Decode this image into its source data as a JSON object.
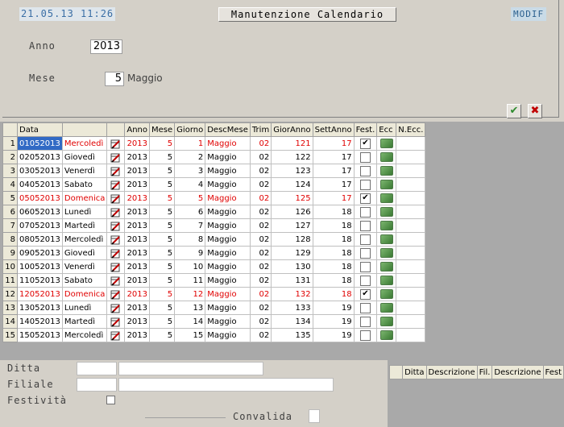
{
  "header": {
    "datetime": "21.05.13 11:26",
    "title": "Manutenzione Calendario",
    "mode": "MODIF"
  },
  "form": {
    "anno_label": "Anno",
    "anno_value": "2013",
    "mese_label": "Mese",
    "mese_value": "5",
    "mese_name": "Maggio"
  },
  "toolbar": {
    "confirm_icon": "checkmark-icon",
    "cancel_icon": "x-icon",
    "confirm_color": "#2e8b2e",
    "cancel_color": "#c00000"
  },
  "grid": {
    "columns": [
      "Data",
      "",
      "",
      "Anno",
      "Mese",
      "Giorno",
      "DescMese",
      "Trim",
      "GiorAnno",
      "SettAnno",
      "Fest.",
      "Ecc",
      "N.Ecc."
    ],
    "rows": [
      {
        "n": "1",
        "data": "01052013",
        "giorno_sett": "Mercoledì",
        "anno": "2013",
        "mese": "5",
        "giorno": "1",
        "desc_mese": "Maggio",
        "trim": "02",
        "gior_anno": "121",
        "sett_anno": "17",
        "fest": true,
        "holiday": true
      },
      {
        "n": "2",
        "data": "02052013",
        "giorno_sett": "Giovedì",
        "anno": "2013",
        "mese": "5",
        "giorno": "2",
        "desc_mese": "Maggio",
        "trim": "02",
        "gior_anno": "122",
        "sett_anno": "17",
        "fest": false,
        "holiday": false
      },
      {
        "n": "3",
        "data": "03052013",
        "giorno_sett": "Venerdì",
        "anno": "2013",
        "mese": "5",
        "giorno": "3",
        "desc_mese": "Maggio",
        "trim": "02",
        "gior_anno": "123",
        "sett_anno": "17",
        "fest": false,
        "holiday": false
      },
      {
        "n": "4",
        "data": "04052013",
        "giorno_sett": "Sabato",
        "anno": "2013",
        "mese": "5",
        "giorno": "4",
        "desc_mese": "Maggio",
        "trim": "02",
        "gior_anno": "124",
        "sett_anno": "17",
        "fest": false,
        "holiday": false
      },
      {
        "n": "5",
        "data": "05052013",
        "giorno_sett": "Domenica",
        "anno": "2013",
        "mese": "5",
        "giorno": "5",
        "desc_mese": "Maggio",
        "trim": "02",
        "gior_anno": "125",
        "sett_anno": "17",
        "fest": true,
        "holiday": true
      },
      {
        "n": "6",
        "data": "06052013",
        "giorno_sett": "Lunedì",
        "anno": "2013",
        "mese": "5",
        "giorno": "6",
        "desc_mese": "Maggio",
        "trim": "02",
        "gior_anno": "126",
        "sett_anno": "18",
        "fest": false,
        "holiday": false
      },
      {
        "n": "7",
        "data": "07052013",
        "giorno_sett": "Martedì",
        "anno": "2013",
        "mese": "5",
        "giorno": "7",
        "desc_mese": "Maggio",
        "trim": "02",
        "gior_anno": "127",
        "sett_anno": "18",
        "fest": false,
        "holiday": false
      },
      {
        "n": "8",
        "data": "08052013",
        "giorno_sett": "Mercoledì",
        "anno": "2013",
        "mese": "5",
        "giorno": "8",
        "desc_mese": "Maggio",
        "trim": "02",
        "gior_anno": "128",
        "sett_anno": "18",
        "fest": false,
        "holiday": false
      },
      {
        "n": "9",
        "data": "09052013",
        "giorno_sett": "Giovedì",
        "anno": "2013",
        "mese": "5",
        "giorno": "9",
        "desc_mese": "Maggio",
        "trim": "02",
        "gior_anno": "129",
        "sett_anno": "18",
        "fest": false,
        "holiday": false
      },
      {
        "n": "10",
        "data": "10052013",
        "giorno_sett": "Venerdì",
        "anno": "2013",
        "mese": "5",
        "giorno": "10",
        "desc_mese": "Maggio",
        "trim": "02",
        "gior_anno": "130",
        "sett_anno": "18",
        "fest": false,
        "holiday": false
      },
      {
        "n": "11",
        "data": "11052013",
        "giorno_sett": "Sabato",
        "anno": "2013",
        "mese": "5",
        "giorno": "11",
        "desc_mese": "Maggio",
        "trim": "02",
        "gior_anno": "131",
        "sett_anno": "18",
        "fest": false,
        "holiday": false
      },
      {
        "n": "12",
        "data": "12052013",
        "giorno_sett": "Domenica",
        "anno": "2013",
        "mese": "5",
        "giorno": "12",
        "desc_mese": "Maggio",
        "trim": "02",
        "gior_anno": "132",
        "sett_anno": "18",
        "fest": true,
        "holiday": true
      },
      {
        "n": "13",
        "data": "13052013",
        "giorno_sett": "Lunedì",
        "anno": "2013",
        "mese": "5",
        "giorno": "13",
        "desc_mese": "Maggio",
        "trim": "02",
        "gior_anno": "133",
        "sett_anno": "19",
        "fest": false,
        "holiday": false
      },
      {
        "n": "14",
        "data": "14052013",
        "giorno_sett": "Martedì",
        "anno": "2013",
        "mese": "5",
        "giorno": "14",
        "desc_mese": "Maggio",
        "trim": "02",
        "gior_anno": "134",
        "sett_anno": "19",
        "fest": false,
        "holiday": false
      },
      {
        "n": "15",
        "data": "15052013",
        "giorno_sett": "Mercoledì",
        "anno": "2013",
        "mese": "5",
        "giorno": "15",
        "desc_mese": "Maggio",
        "trim": "02",
        "gior_anno": "135",
        "sett_anno": "19",
        "fest": false,
        "holiday": false
      }
    ],
    "holiday_color": "#e00000",
    "selected_color": "#316ac5"
  },
  "bottom": {
    "ditta_label": "Ditta",
    "filiale_label": "Filiale",
    "festivita_label": "Festività",
    "convalida_label": "Convalida"
  },
  "subgrid": {
    "columns": [
      "Ditta",
      "Descrizione",
      "Fil.",
      "Descrizione",
      "Fest"
    ]
  }
}
